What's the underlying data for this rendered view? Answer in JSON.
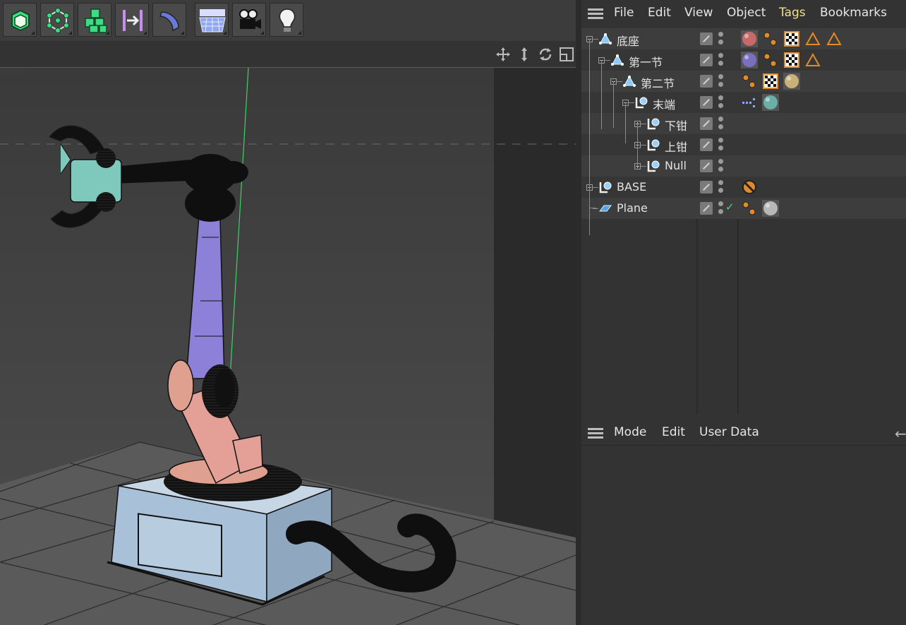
{
  "toolbar": {
    "tools": [
      {
        "name": "cube-object-icon"
      },
      {
        "name": "points-mode-icon"
      },
      {
        "name": "cubes-group-icon"
      },
      {
        "name": "symmetry-icon"
      },
      {
        "name": "deformer-icon"
      },
      {
        "name": "floor-grid-icon"
      },
      {
        "name": "camera-icon"
      },
      {
        "name": "light-bulb-icon"
      }
    ]
  },
  "viewport": {
    "nav_icons": [
      "move-view-icon",
      "zoom-view-icon",
      "rotate-view-icon",
      "maximize-view-icon"
    ]
  },
  "object_manager": {
    "menu": [
      "File",
      "Edit",
      "View",
      "Object",
      "Tags",
      "Bookmarks"
    ],
    "active_menu": "Tags",
    "objects": [
      {
        "name": "底座",
        "depth": 0,
        "type": "bone",
        "tags": [
          "material-red",
          "dots",
          "checker",
          "triangle",
          "triangle"
        ]
      },
      {
        "name": "第一节",
        "depth": 1,
        "type": "bone",
        "tags": [
          "material-purple",
          "dots",
          "checker",
          "triangle"
        ]
      },
      {
        "name": "第二节",
        "depth": 2,
        "type": "bone",
        "tags": [
          "dots",
          "checker",
          "material-yellow"
        ]
      },
      {
        "name": "末端",
        "depth": 3,
        "type": "null",
        "tags": [
          "ik",
          "material-teal"
        ]
      },
      {
        "name": "下钳",
        "depth": 4,
        "type": "null",
        "tags": []
      },
      {
        "name": "上钳",
        "depth": 4,
        "type": "null",
        "tags": []
      },
      {
        "name": "Null",
        "depth": 4,
        "type": "null",
        "tags": []
      },
      {
        "name": "BASE",
        "depth": 0,
        "type": "null",
        "tags": [
          "protection"
        ]
      },
      {
        "name": "Plane",
        "depth": 0,
        "type": "plane",
        "tags": [
          "dots",
          "material-gray"
        ],
        "checked": true
      }
    ]
  },
  "attribute_manager": {
    "menu": [
      "Mode",
      "Edit",
      "User Data"
    ]
  },
  "colors": {
    "active_menu": "#f0e08a",
    "material_red": "#c86a6a",
    "material_purple": "#7a70c0",
    "material_yellow": "#c8b27a",
    "material_teal": "#6ab0a8",
    "material_gray": "#b8b8b8",
    "tag_orange": "#e08a2a"
  }
}
